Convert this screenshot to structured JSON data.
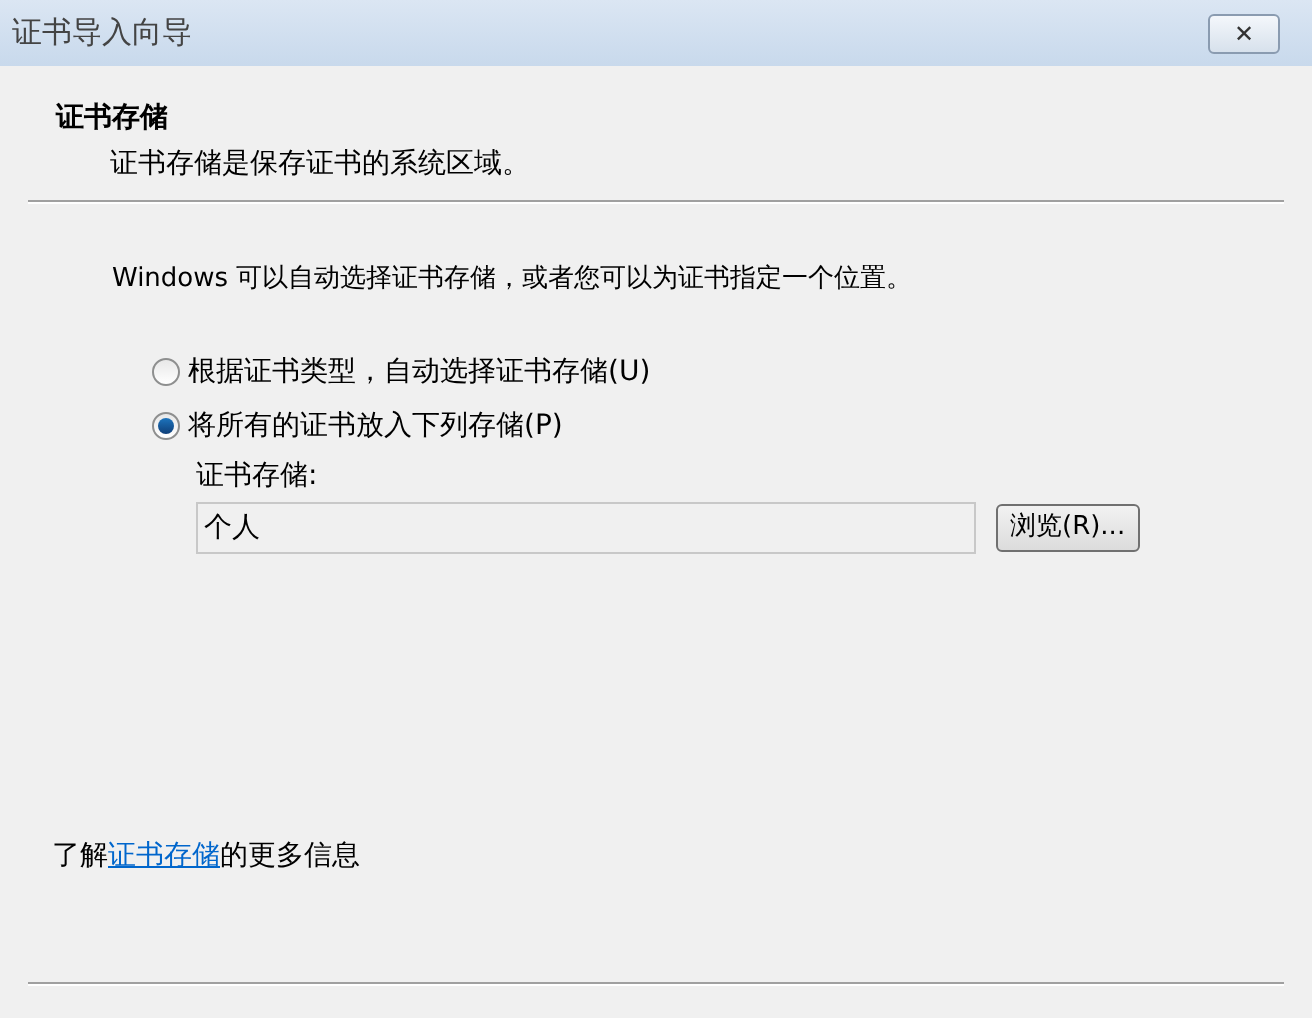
{
  "window": {
    "title": "证书导入向导",
    "close_label": "✕"
  },
  "header": {
    "title": "证书存储",
    "subtitle": "证书存储是保存证书的系统区域。"
  },
  "intro": "Windows 可以自动选择证书存储，或者您可以为证书指定一个位置。",
  "options": [
    {
      "label": "根据证书类型，自动选择证书存储(U)",
      "selected": false
    },
    {
      "label": "将所有的证书放入下列存储(P)",
      "selected": true
    }
  ],
  "store": {
    "label": "证书存储:",
    "value": "个人",
    "browse_button": "浏览(R)..."
  },
  "more_info": {
    "before": "了解",
    "link": "证书存储",
    "after": "的更多信息"
  }
}
